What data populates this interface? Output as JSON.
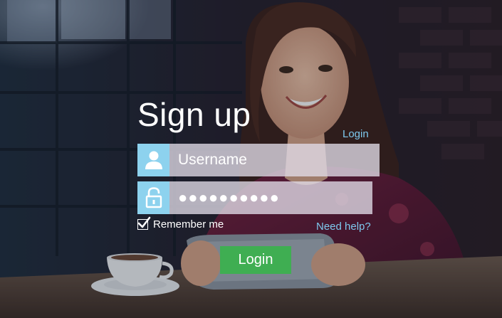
{
  "form": {
    "title": "Sign up",
    "top_login_link": "Login",
    "username": {
      "placeholder": "Username",
      "value": ""
    },
    "password": {
      "value": "●●●●●●●●●●"
    },
    "remember_me": {
      "label": "Remember me",
      "checked": true
    },
    "help_link": "Need help?",
    "login_button": "Login"
  },
  "icons": {
    "username": "user-icon",
    "password": "unlock-icon",
    "checkbox": "checkmark-icon"
  },
  "colors": {
    "icon_box": "#8dd2ee",
    "link": "#7ec9ee",
    "login_button": "#3fae52"
  }
}
